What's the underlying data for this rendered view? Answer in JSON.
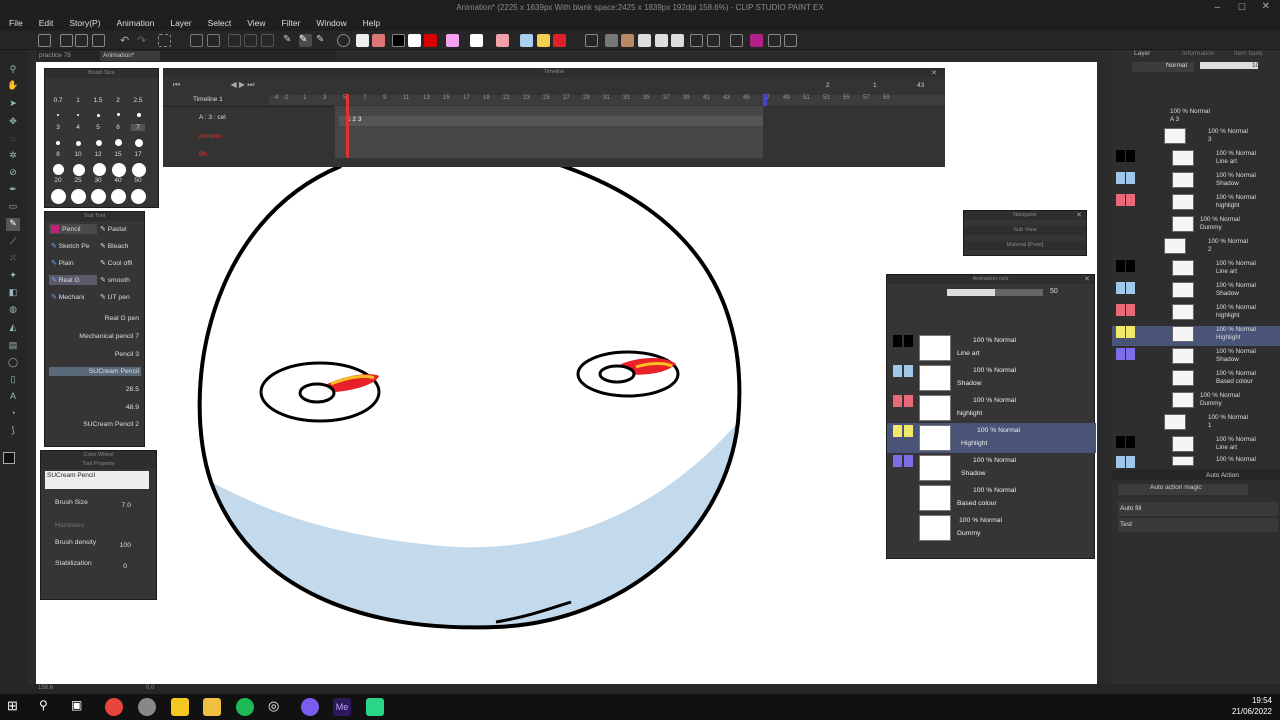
{
  "app": {
    "title": "Animation* (2225 x 1639px With blank space:2425 x 1839px 192dpi 158.6%) - CLIP STUDIO PAINT EX"
  },
  "menu": [
    "File",
    "Edit",
    "Story(P)",
    "Animation",
    "Layer",
    "Select",
    "View",
    "Filter",
    "Window",
    "Help"
  ],
  "tabs": [
    "practice 78",
    "Animation*"
  ],
  "brush_size": {
    "title": "Brush Size",
    "row1": [
      "0.7",
      "1",
      "1.5",
      "2",
      "2.5"
    ],
    "row2": [
      "3",
      "4",
      "5",
      "6",
      "7"
    ],
    "row3": [
      "8",
      "10",
      "12",
      "15",
      "17"
    ],
    "row4": [
      "20",
      "25",
      "30",
      "40",
      "50"
    ]
  },
  "sub_tool": {
    "title": "Sub Tool",
    "left": [
      "Pencil",
      "Sketch Pe",
      "Plain",
      "Real G",
      "Mechani"
    ],
    "right": [
      "Pastel",
      "Bleach",
      "Cool offi",
      "smooth",
      "UT pen"
    ],
    "list": [
      "Real G pen",
      "Mechanical pencil 7",
      "Pencil 3",
      "SUCream Pencil"
    ],
    "size_a": "28.5",
    "size_b": "48.9",
    "footer": "SUCream Pencil 2"
  },
  "tool_property": {
    "tabs": "Color Wheel",
    "title": "Tool Property",
    "brush_name": "SUCream Pencil",
    "brush_size_label": "Brush Size",
    "brush_size_value": "7.0",
    "hardness_label": "Hardness",
    "density_label": "Brush density",
    "density_value": "100",
    "stabilization_label": "Stabilization",
    "stabilization_value": "0"
  },
  "timeline": {
    "title": "Timeline",
    "name": "Timeline 1",
    "track1": "A : 3 : cel",
    "track2": "Atmoim",
    "track3": "Bh",
    "frames": [
      "-4",
      "-2",
      "1",
      "3",
      "5",
      "7",
      "9",
      "11",
      "13",
      "15",
      "17",
      "19",
      "21",
      "23",
      "25",
      "27",
      "29",
      "31",
      "33",
      "35",
      "37",
      "39",
      "41",
      "43",
      "45",
      "47",
      "49",
      "51",
      "53",
      "55",
      "57",
      "59"
    ],
    "cel_marks": "1  2  3",
    "top_right": [
      "2",
      "1",
      "43"
    ]
  },
  "navigator": {
    "title": "Navigator",
    "sub_view": "Sub View",
    "material": "Material [Pose]"
  },
  "animation_cels": {
    "title": "Animation cels",
    "opacity": "50",
    "cels": [
      {
        "mode": "100 % Normal",
        "name": "Line art",
        "color": "#000000"
      },
      {
        "mode": "100 % Normal",
        "name": "Shadow",
        "color": "#9ec7ea"
      },
      {
        "mode": "100 % Normal",
        "name": "highlight",
        "color": "#e86a78"
      },
      {
        "mode": "100 % Normal",
        "name": "Highlight",
        "color": "#f2e86a"
      },
      {
        "mode": "100 % Normal",
        "name": "Shadow",
        "color": "#7b6ee6"
      },
      {
        "mode": "100 % Normal",
        "name": "Based colour",
        "color": ""
      },
      {
        "mode": "100 % Normal",
        "name": "Dummy",
        "color": ""
      }
    ]
  },
  "layer_panel": {
    "tabs": [
      "Layer",
      "Information",
      "Item bank"
    ],
    "blend": "Normal",
    "opacity": "100",
    "rows": [
      {
        "mode": "100 % Normal",
        "name": "A 3"
      },
      {
        "mode": "100 % Normal",
        "name": "3"
      },
      {
        "mode": "100 % Normal",
        "name": "Line art"
      },
      {
        "mode": "100 % Normal",
        "name": "Shadow"
      },
      {
        "mode": "100 % Normal",
        "name": "highlight"
      },
      {
        "mode": "100 % Normal",
        "name": "Dummy"
      },
      {
        "mode": "100 % Normal",
        "name": "2"
      },
      {
        "mode": "100 % Normal",
        "name": "Line art"
      },
      {
        "mode": "100 % Normal",
        "name": "Shadow"
      },
      {
        "mode": "100 % Normal",
        "name": "highlight"
      },
      {
        "mode": "100 % Normal",
        "name": "Highlight"
      },
      {
        "mode": "100 % Normal",
        "name": "Shadow"
      },
      {
        "mode": "100 % Normal",
        "name": "Based colour"
      },
      {
        "mode": "100 % Normal",
        "name": "Dummy"
      },
      {
        "mode": "100 % Normal",
        "name": "1"
      },
      {
        "mode": "100 % Normal",
        "name": "Line art"
      },
      {
        "mode": "100 % Normal",
        "name": "Shadow"
      }
    ],
    "auto_action_tab": "Auto Action",
    "auto_action_select": "Auto action magic",
    "auto_actions": [
      "Auto fill",
      "Test"
    ]
  },
  "status": {
    "zoom": "158.6",
    "angle": "0.0"
  },
  "taskbar": {
    "time": "19:54",
    "date": "21/06/2022"
  }
}
